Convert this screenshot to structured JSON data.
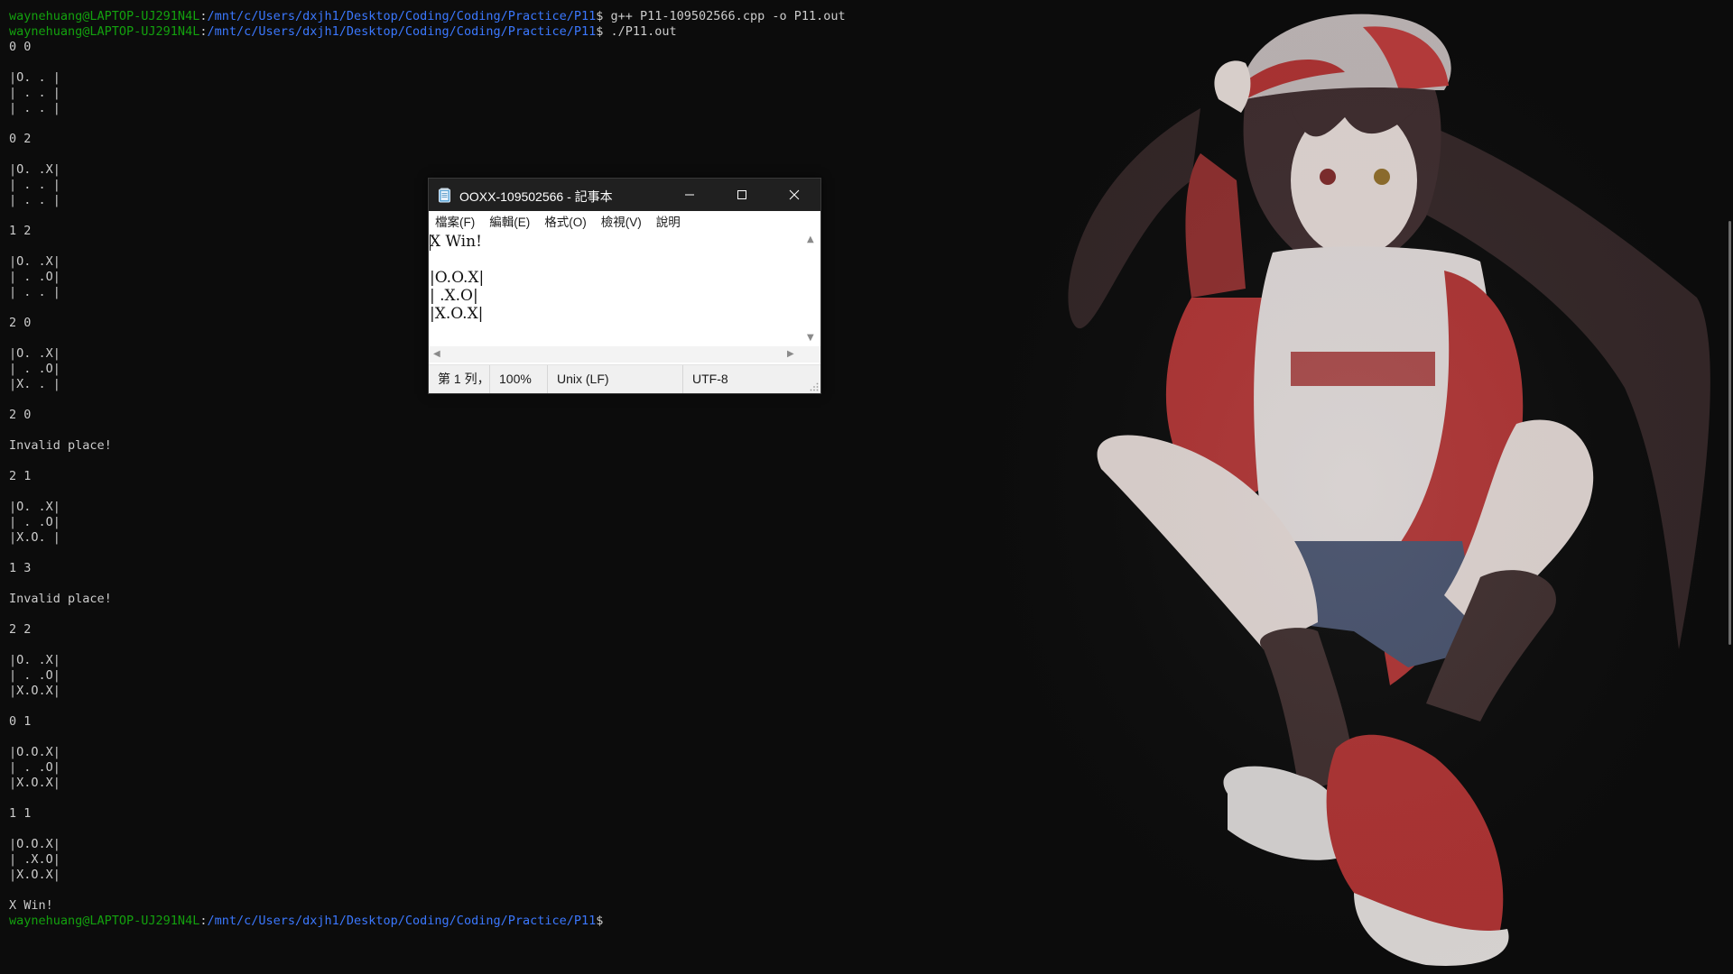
{
  "terminal": {
    "prompt_user": "waynehuang@LAPTOP-UJ291N4L",
    "prompt_sep": ":",
    "prompt_path": "/mnt/c/Users/dxjh1/Desktop/Coding/Coding/Practice/P11",
    "prompt_end": "$ ",
    "lines": [
      {
        "type": "prompt",
        "cmd": "g++ P11-109502566.cpp -o P11.out"
      },
      {
        "type": "prompt",
        "cmd": "./P11.out"
      },
      {
        "type": "text",
        "text": "0 0"
      },
      {
        "type": "text",
        "text": ""
      },
      {
        "type": "text",
        "text": "|O. . |"
      },
      {
        "type": "text",
        "text": "| . . |"
      },
      {
        "type": "text",
        "text": "| . . |"
      },
      {
        "type": "text",
        "text": ""
      },
      {
        "type": "text",
        "text": "0 2"
      },
      {
        "type": "text",
        "text": ""
      },
      {
        "type": "text",
        "text": "|O. .X|"
      },
      {
        "type": "text",
        "text": "| . . |"
      },
      {
        "type": "text",
        "text": "| . . |"
      },
      {
        "type": "text",
        "text": ""
      },
      {
        "type": "text",
        "text": "1 2"
      },
      {
        "type": "text",
        "text": ""
      },
      {
        "type": "text",
        "text": "|O. .X|"
      },
      {
        "type": "text",
        "text": "| . .O|"
      },
      {
        "type": "text",
        "text": "| . . |"
      },
      {
        "type": "text",
        "text": ""
      },
      {
        "type": "text",
        "text": "2 0"
      },
      {
        "type": "text",
        "text": ""
      },
      {
        "type": "text",
        "text": "|O. .X|"
      },
      {
        "type": "text",
        "text": "| . .O|"
      },
      {
        "type": "text",
        "text": "|X. . |"
      },
      {
        "type": "text",
        "text": ""
      },
      {
        "type": "text",
        "text": "2 0"
      },
      {
        "type": "text",
        "text": ""
      },
      {
        "type": "text",
        "text": "Invalid place!"
      },
      {
        "type": "text",
        "text": ""
      },
      {
        "type": "text",
        "text": "2 1"
      },
      {
        "type": "text",
        "text": ""
      },
      {
        "type": "text",
        "text": "|O. .X|"
      },
      {
        "type": "text",
        "text": "| . .O|"
      },
      {
        "type": "text",
        "text": "|X.O. |"
      },
      {
        "type": "text",
        "text": ""
      },
      {
        "type": "text",
        "text": "1 3"
      },
      {
        "type": "text",
        "text": ""
      },
      {
        "type": "text",
        "text": "Invalid place!"
      },
      {
        "type": "text",
        "text": ""
      },
      {
        "type": "text",
        "text": "2 2"
      },
      {
        "type": "text",
        "text": ""
      },
      {
        "type": "text",
        "text": "|O. .X|"
      },
      {
        "type": "text",
        "text": "| . .O|"
      },
      {
        "type": "text",
        "text": "|X.O.X|"
      },
      {
        "type": "text",
        "text": ""
      },
      {
        "type": "text",
        "text": "0 1"
      },
      {
        "type": "text",
        "text": ""
      },
      {
        "type": "text",
        "text": "|O.O.X|"
      },
      {
        "type": "text",
        "text": "| . .O|"
      },
      {
        "type": "text",
        "text": "|X.O.X|"
      },
      {
        "type": "text",
        "text": ""
      },
      {
        "type": "text",
        "text": "1 1"
      },
      {
        "type": "text",
        "text": ""
      },
      {
        "type": "text",
        "text": "|O.O.X|"
      },
      {
        "type": "text",
        "text": "| .X.O|"
      },
      {
        "type": "text",
        "text": "|X.O.X|"
      },
      {
        "type": "text",
        "text": ""
      },
      {
        "type": "text",
        "text": "X Win!"
      },
      {
        "type": "prompt",
        "cmd": ""
      }
    ]
  },
  "notepad": {
    "title": "OOXX-109502566 - 記事本",
    "menu": [
      "檔案(F)",
      "編輯(E)",
      "格式(O)",
      "檢視(V)",
      "說明"
    ],
    "content": "X Win!\n\n|O.O.X|\n| .X.O|\n|X.O.X|",
    "status": {
      "position": "第 1 列，",
      "zoom": "100%",
      "line_ending": "Unix (LF)",
      "encoding": "UTF-8"
    },
    "icons": {
      "app": "notepad-icon",
      "minimize": "minimize-icon",
      "maximize": "maximize-icon",
      "close": "close-icon"
    }
  },
  "colors": {
    "terminal_bg": "#0c0c0c",
    "terminal_fg": "#cccccc",
    "prompt_user": "#13a10e",
    "prompt_path": "#3b78ff",
    "titlebar_bg": "#202020"
  },
  "background_image": "anime-girl-wallpaper"
}
